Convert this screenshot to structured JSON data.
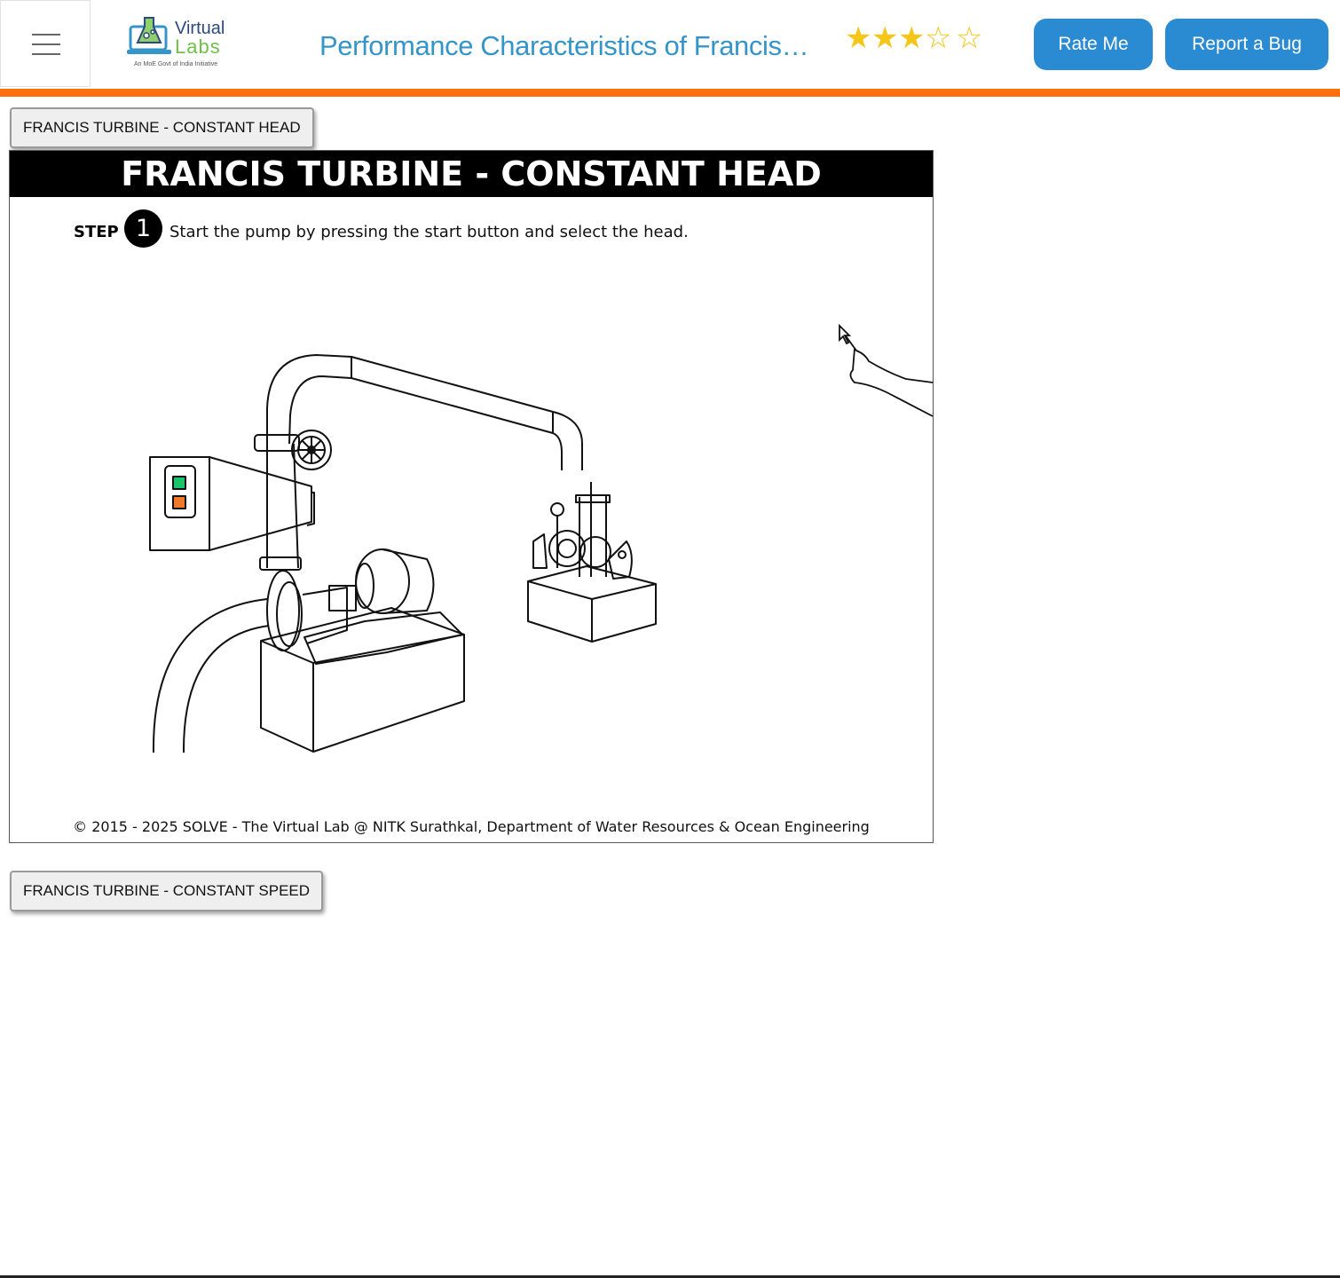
{
  "header": {
    "menu_icon": "hamburger-menu-icon",
    "logo": {
      "line1": "Virtual",
      "line2": "Labs",
      "tagline": "An MoE Govt of India Initiative"
    },
    "title": "Performance Characteristics of Francis…",
    "rating": {
      "value": 3,
      "max": 5
    },
    "rate_label": "Rate Me",
    "bug_label": "Report a Bug"
  },
  "colors": {
    "accent_bar": "#ff6f0f",
    "button_blue": "#2b8bd2",
    "title_blue": "#3595c9",
    "star": "#f5c518"
  },
  "sections": {
    "constant_head_label": "FRANCIS TURBINE - CONSTANT HEAD",
    "constant_speed_label": "FRANCIS TURBINE - CONSTANT SPEED"
  },
  "simulation": {
    "title": "FRANCIS TURBINE - CONSTANT HEAD",
    "step_word": "STEP",
    "step_number": "1",
    "instruction": "Start the pump by pressing the start button and select the head.",
    "copyright": "© 2015 - 2025 SOLVE - The Virtual Lab @ NITK Surathkal, Department of Water Resources & Ocean Engineering"
  }
}
